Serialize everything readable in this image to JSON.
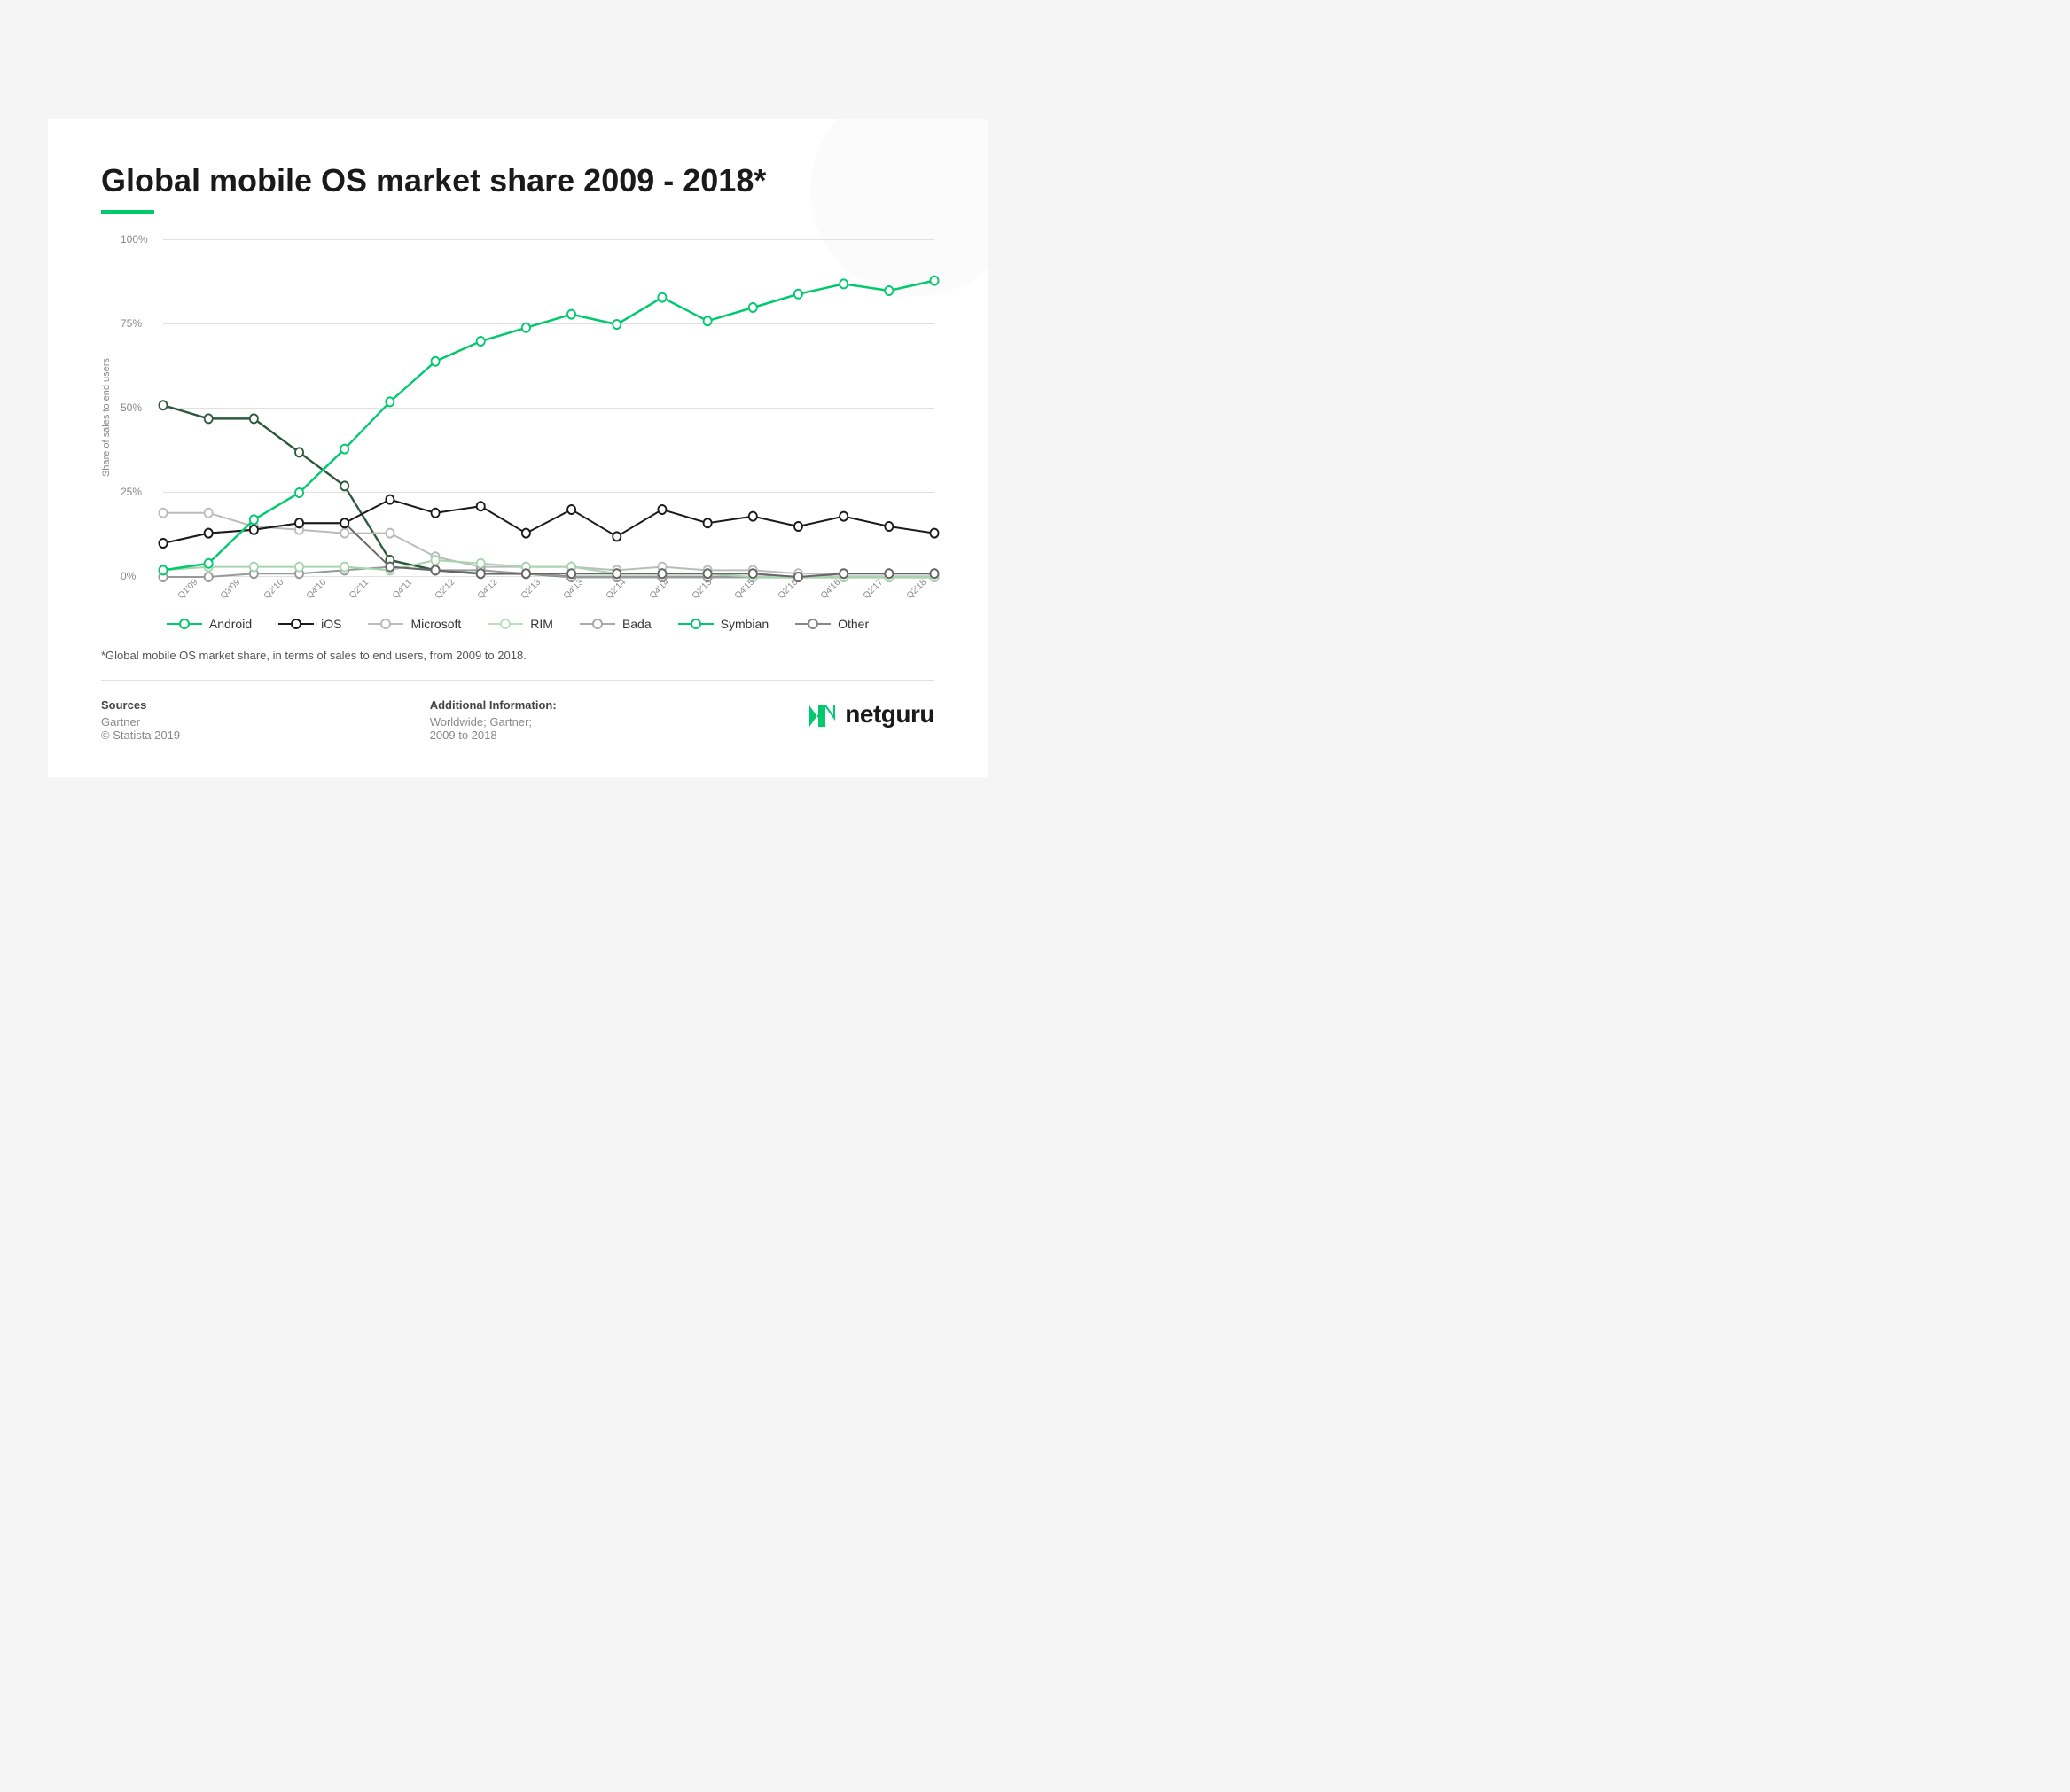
{
  "page": {
    "title": "Global mobile OS market share 2009 - 2018*",
    "footnote": "*Global mobile OS market share, in terms of sales to end users, from 2009 to 2018.",
    "y_axis_label": "Share of sales to end users",
    "y_ticks": [
      "100%",
      "75%",
      "50%",
      "25%",
      "0%"
    ],
    "x_labels": [
      "Q1'09",
      "Q3'09",
      "Q2'10",
      "Q4'10",
      "Q2'11",
      "Q4'11",
      "Q2'12",
      "Q4'12",
      "Q2'13",
      "Q4'13",
      "Q2'14",
      "Q4'14",
      "Q2'15",
      "Q4'15",
      "Q2'16",
      "Q4'16",
      "Q2'17",
      "Q2'18"
    ],
    "sources_title": "Sources",
    "sources_lines": [
      "Gartner",
      "© Statista 2019"
    ],
    "additional_info_title": "Additional Information:",
    "additional_info_lines": [
      "Worldwide; Gartner;",
      "2009 to 2018"
    ],
    "logo_n": "N",
    "logo_text": "netguru",
    "legend": [
      {
        "label": "Android",
        "color": "#00c96e",
        "id": "android"
      },
      {
        "label": "iOS",
        "color": "#1a1a1a",
        "id": "ios"
      },
      {
        "label": "Microsoft",
        "color": "#bbbbbb",
        "id": "microsoft"
      },
      {
        "label": "RIM",
        "color": "#b8e0c0",
        "id": "rim"
      },
      {
        "label": "Bada",
        "color": "#aaaaaa",
        "id": "bada"
      },
      {
        "label": "Symbian",
        "color": "#00c96e",
        "id": "symbian"
      },
      {
        "label": "Other",
        "color": "#888888",
        "id": "other"
      }
    ],
    "series": {
      "android": [
        2,
        4,
        17,
        25,
        38,
        52,
        64,
        70,
        74,
        78,
        75,
        83,
        76,
        80,
        84,
        87,
        85,
        88
      ],
      "ios": [
        10,
        13,
        14,
        16,
        16,
        23,
        19,
        21,
        13,
        20,
        12,
        20,
        16,
        18,
        15,
        18,
        15,
        13
      ],
      "microsoft": [
        19,
        19,
        15,
        14,
        13,
        13,
        6,
        3,
        3,
        3,
        2,
        3,
        2,
        2,
        1,
        1,
        1,
        1
      ],
      "rim": [
        2,
        3,
        3,
        3,
        3,
        2,
        5,
        4,
        3,
        3,
        1,
        1,
        1,
        0,
        0,
        0,
        0,
        0
      ],
      "bada": [
        0,
        0,
        1,
        1,
        2,
        3,
        2,
        2,
        1,
        0,
        0,
        0,
        0,
        0,
        0,
        0,
        0,
        0
      ],
      "symbian": [
        51,
        47,
        47,
        37,
        27,
        5,
        2,
        1,
        1,
        0,
        0,
        0,
        0,
        0,
        0,
        0,
        0,
        0
      ],
      "other": [
        10,
        13,
        14,
        16,
        16,
        3,
        2,
        1,
        1,
        1,
        1,
        1,
        1,
        1,
        0,
        1,
        1,
        1
      ]
    }
  }
}
